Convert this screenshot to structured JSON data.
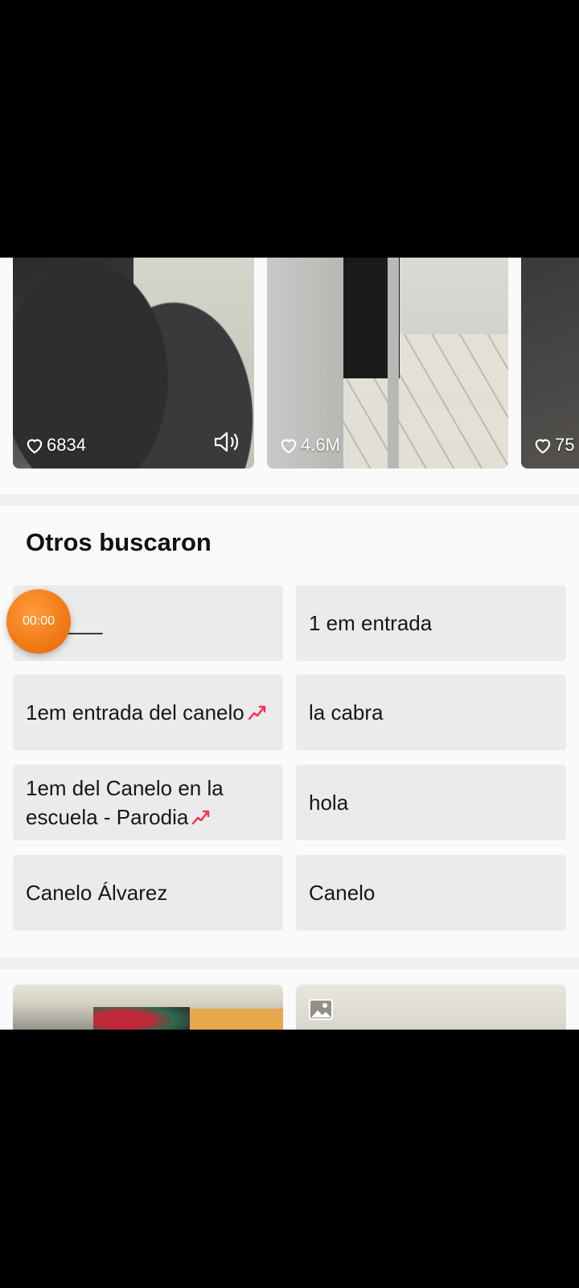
{
  "videos": [
    {
      "likes": "6834",
      "has_sound_icon": true
    },
    {
      "likes": "4.6M",
      "has_sound_icon": false
    },
    {
      "likes": "75",
      "has_sound_icon": false
    }
  ],
  "related": {
    "title": "Otros buscaron",
    "items": [
      {
        "label": "___",
        "trending": false
      },
      {
        "label": "1 em entrada",
        "trending": false
      },
      {
        "label": "1em entrada del canelo",
        "trending": true
      },
      {
        "label": "la cabra",
        "trending": false
      },
      {
        "label": "1em del Canelo en la escuela - Parodia",
        "trending": true
      },
      {
        "label": "hola",
        "trending": false
      },
      {
        "label": "Canelo Álvarez",
        "trending": false
      },
      {
        "label": "Canelo",
        "trending": false
      }
    ]
  },
  "timer_overlay": "00:00",
  "colors": {
    "trend": "#fe2c55",
    "timer": "#f07a16",
    "chip": "#ebebeb"
  }
}
